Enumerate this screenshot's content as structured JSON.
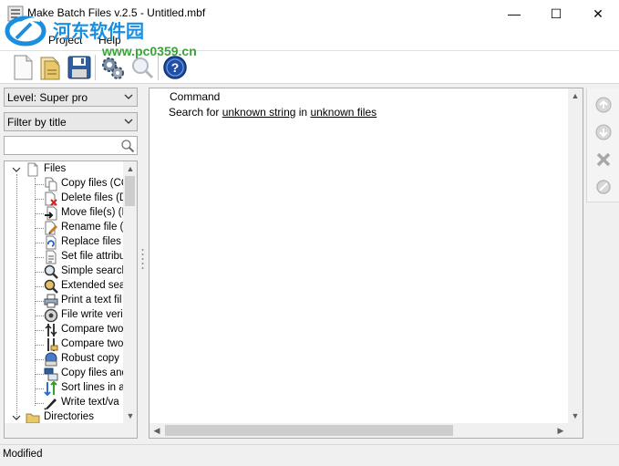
{
  "window": {
    "title": "Make Batch Files v.2.5 - Untitled.mbf",
    "minimize_glyph": "—",
    "maximize_glyph": "☐",
    "close_glyph": "✕"
  },
  "watermark": {
    "site_name": "河东软件园",
    "url": "www.pc0359.cn"
  },
  "menu": {
    "project": "Project",
    "help": "Help"
  },
  "toolbar": {
    "buttons": [
      "new-file-icon",
      "open-file-icon",
      "save-icon",
      "settings-icon",
      "preview-icon",
      "help-icon"
    ]
  },
  "left_panel": {
    "level_select": "Level: Super pro",
    "filter_select": "Filter by title",
    "search_placeholder": "",
    "tree": {
      "files_group": "Files",
      "items": [
        "Copy files (CO",
        "Delete files (D",
        "Move file(s) (M",
        "Rename file (R",
        "Replace files (",
        "Set file attribu",
        "Simple search",
        "Extended sea",
        "Print a text fil",
        "File write veri",
        "Compare two",
        "Compare two",
        "Robust copy",
        "Copy files and",
        "Sort lines in a",
        "Write text/va"
      ],
      "directories_group": "Directories"
    }
  },
  "main_panel": {
    "column_header": "Command",
    "row": {
      "prefix": "Search for ",
      "param1": "unknown string",
      "middle": " in ",
      "param2": "unknown files"
    }
  },
  "side_buttons": [
    "move-up-icon",
    "move-down-icon",
    "delete-icon",
    "disable-icon"
  ],
  "status": {
    "text": "Modified"
  },
  "colors": {
    "accent_blue": "#1a8fe0",
    "watermark_green": "#3aa33a"
  }
}
